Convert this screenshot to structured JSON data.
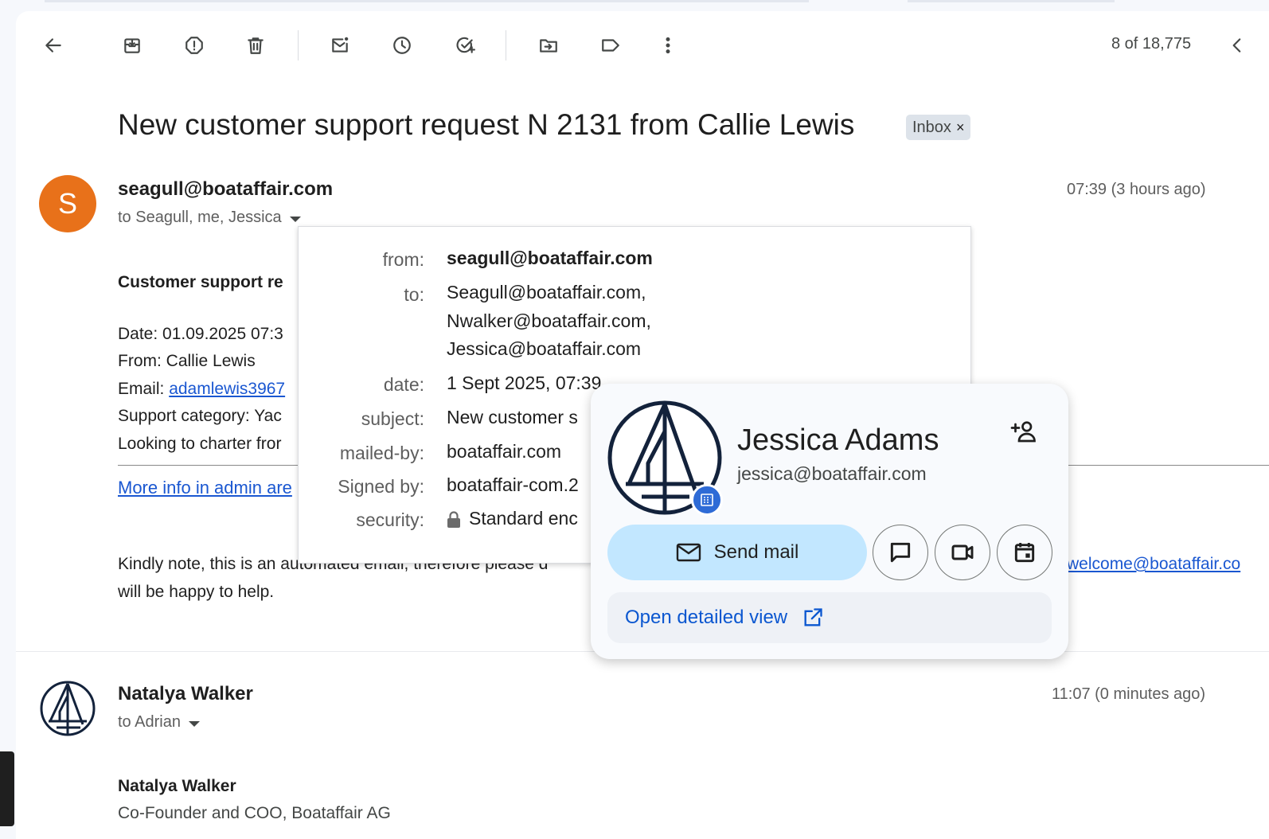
{
  "toolbar": {
    "icons": [
      "back-arrow-icon",
      "archive-icon",
      "report-spam-icon",
      "delete-icon",
      "mark-unread-icon",
      "snooze-icon",
      "add-to-tasks-icon",
      "move-to-icon",
      "label-icon",
      "more-vert-icon",
      "prev-chevron-icon"
    ],
    "pager": "8 of 18,775"
  },
  "thread": {
    "subject": "New customer support request N 2131 from Callie Lewis",
    "label_chip": "Inbox",
    "label_remove": "×"
  },
  "message1": {
    "avatar_letter": "S",
    "avatar_color": "#e8711a",
    "sender": "seagull@boataffair.com",
    "recipients": "to Seagull, me, Jessica",
    "time": "07:39 (3 hours ago)",
    "body_heading": "Customer support re",
    "body_date": "Date: 01.09.2025 07:3",
    "body_from": "From: Callie Lewis",
    "body_email_label": "Email: ",
    "body_email_link": "adamlewis3967",
    "body_category": "Support category: Yac",
    "body_text": "Looking to charter fror",
    "more_info_link": "More info in admin are",
    "note_line1": "Kindly note, this is an automated email, therefore please d",
    "note_line2": "will be happy to help.",
    "note_link": "welcome@boataffair.co"
  },
  "details_popup": {
    "from_label": "from:",
    "from_value": "seagull@boataffair.com",
    "to_label": "to:",
    "to_line1": "Seagull@boataffair.com,",
    "to_line2": "Nwalker@boataffair.com,",
    "to_line3": "Jessica@boataffair.com",
    "date_label": "date:",
    "date_value": "1 Sept 2025, 07:39",
    "subject_label": "subject:",
    "subject_value": "New customer s",
    "mailedby_label": "mailed-by:",
    "mailedby_value": "boataffair.com",
    "signedby_label": "Signed by:",
    "signedby_value": "boataffair-com.2",
    "security_label": "security:",
    "security_value": "Standard enc"
  },
  "contact_card": {
    "name": "Jessica Adams",
    "email": "jessica@boataffair.com",
    "send_mail": "Send mail",
    "open_detailed_view": "Open detailed view"
  },
  "message2": {
    "sender": "Natalya Walker",
    "recipients": "to Adrian",
    "time": "11:07 (0 minutes ago)",
    "signature_name": "Natalya Walker",
    "signature_title": "Co-Founder and COO, Boataffair AG"
  },
  "colors": {
    "link": "#1a57d1",
    "send_mail_bg": "#c2e7ff",
    "chip_bg": "#dde3ea",
    "logo_navy": "#13223b"
  }
}
